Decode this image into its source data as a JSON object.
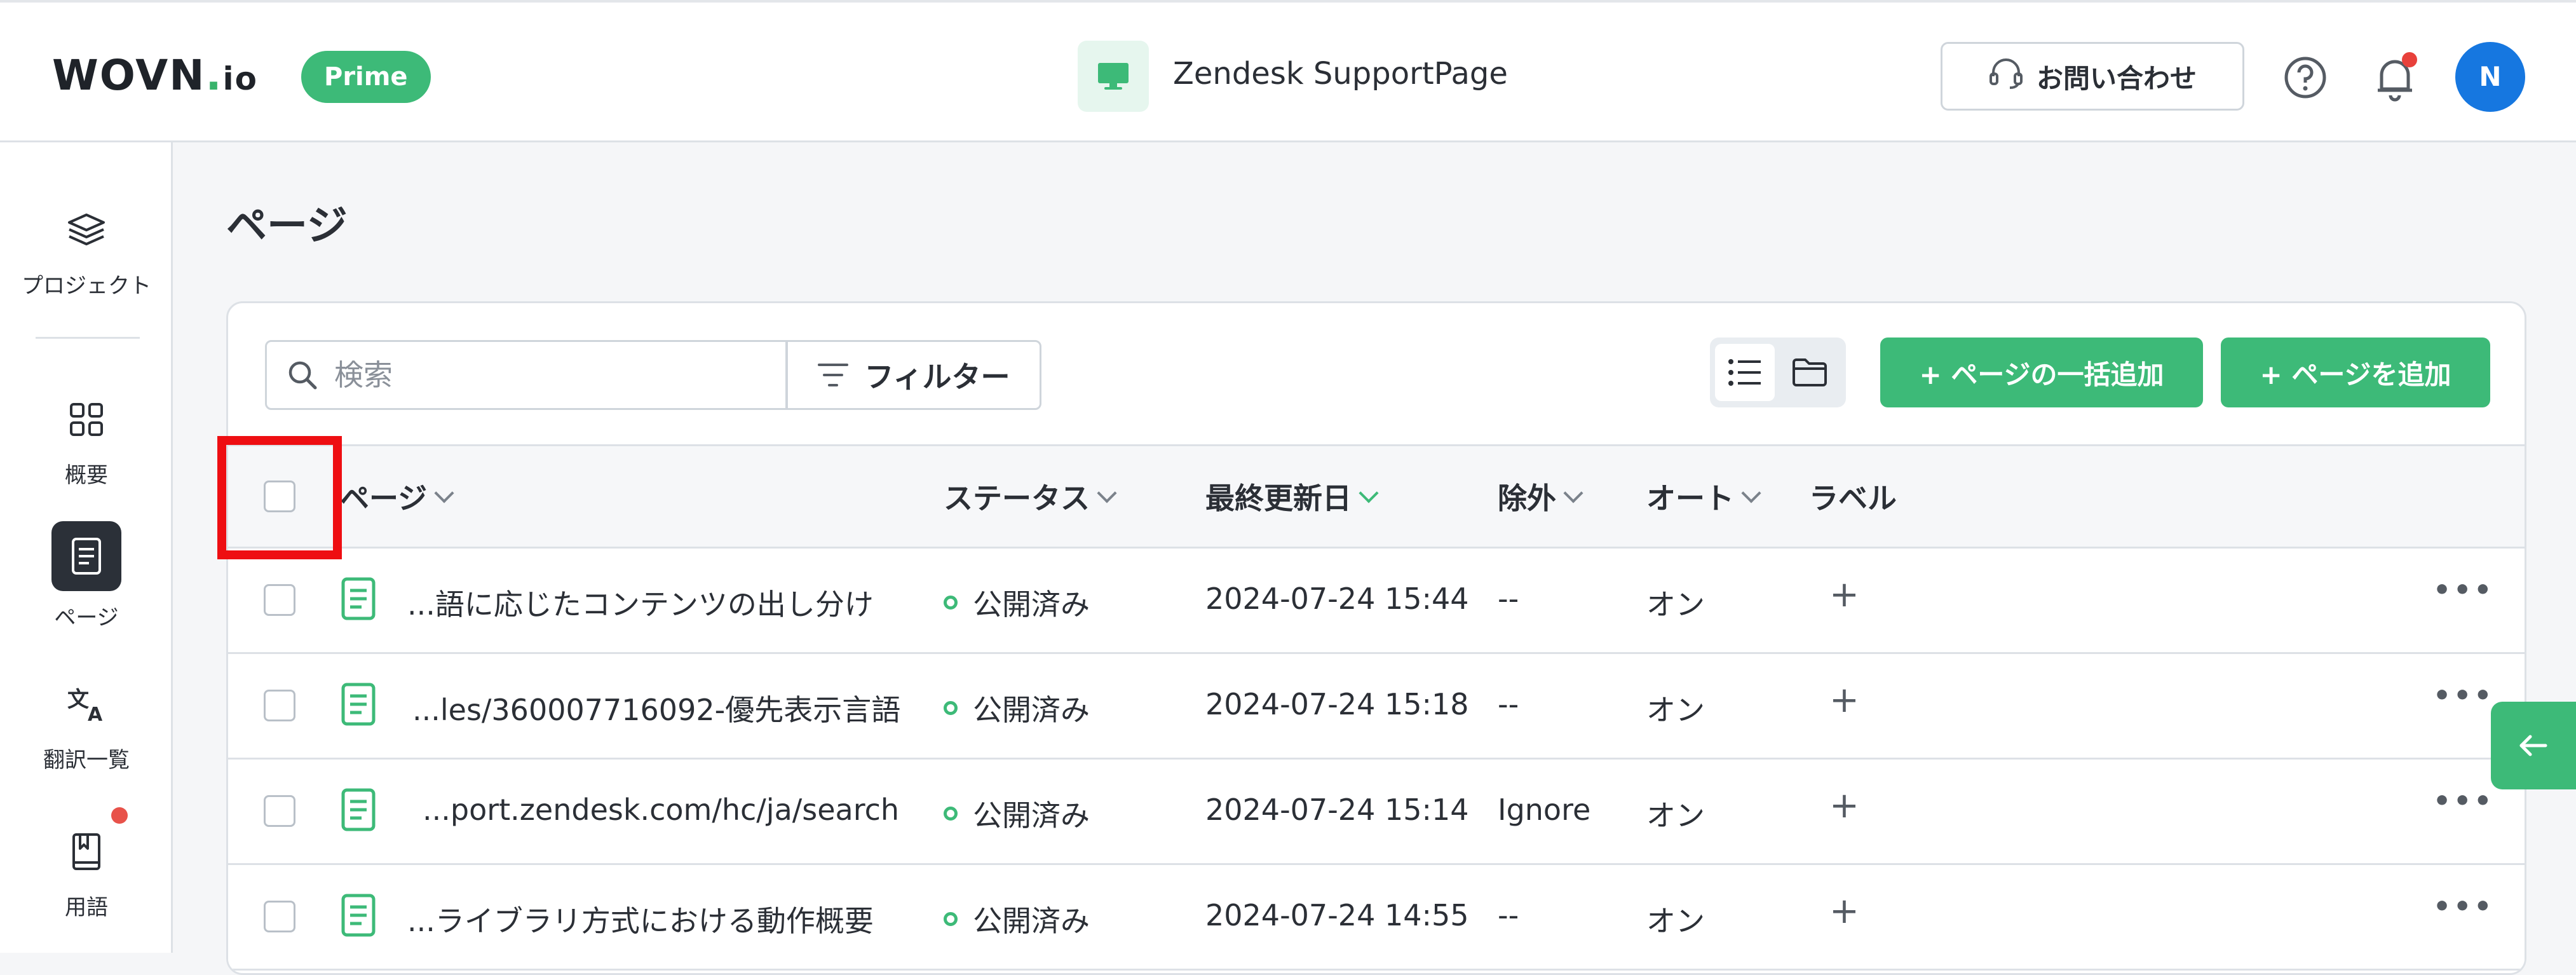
{
  "header": {
    "logo": {
      "main": "WOVN",
      "dot": ".",
      "suffix": "io"
    },
    "plan_badge": "Prime",
    "project_name": "Zendesk SupportPage",
    "contact_label": "お問い合わせ",
    "avatar_initial": "N",
    "icons": [
      "monitor-icon",
      "headset-icon",
      "help-icon",
      "bell-icon"
    ],
    "notification_dot_color": "#e8413b"
  },
  "sidebar": {
    "items": [
      {
        "label": "プロジェクト",
        "icon": "layers-icon",
        "active": false
      },
      {
        "label": "概要",
        "icon": "grid-icon",
        "active": false
      },
      {
        "label": "ページ",
        "icon": "document-icon",
        "active": true
      },
      {
        "label": "翻訳一覧",
        "icon": "translate-icon",
        "active": false
      },
      {
        "label": "用語",
        "icon": "book-icon",
        "active": false,
        "badge_dot": true
      }
    ]
  },
  "main": {
    "title": "ページ",
    "search": {
      "placeholder": "検索",
      "value": ""
    },
    "filter_label": "フィルター",
    "view_modes": [
      "list-view-icon",
      "folder-view-icon"
    ],
    "active_view": "list",
    "bulk_add_label": "+ ページの一括追加",
    "add_label": "+ ページを追加",
    "table": {
      "columns": [
        "ページ",
        "ステータス",
        "最終更新日",
        "除外",
        "オート",
        "ラベル"
      ],
      "sorted_column": "最終更新日",
      "rows": [
        {
          "page": "...語に応じたコンテンツの出し分け",
          "status": "公開済み",
          "updated": "2024-07-24 15:44",
          "exclude": "--",
          "auto": "オン",
          "label": "+",
          "menu": "•••"
        },
        {
          "page": "...les/360007716092-優先表示言語",
          "status": "公開済み",
          "updated": "2024-07-24 15:18",
          "exclude": "--",
          "auto": "オン",
          "label": "+",
          "menu": "•••"
        },
        {
          "page": "...port.zendesk.com/hc/ja/search",
          "status": "公開済み",
          "updated": "2024-07-24 15:14",
          "exclude": "Ignore",
          "auto": "オン",
          "label": "+",
          "menu": "•••"
        },
        {
          "page": "...ライブラリ方式における動作概要",
          "status": "公開済み",
          "updated": "2024-07-24 14:55",
          "exclude": "--",
          "auto": "オン",
          "label": "+",
          "menu": "•••"
        }
      ]
    }
  },
  "colors": {
    "accent": "#3dba78",
    "avatar": "#1677e0",
    "highlight": "#ee0e12",
    "sidebar_active": "#2b3038"
  }
}
